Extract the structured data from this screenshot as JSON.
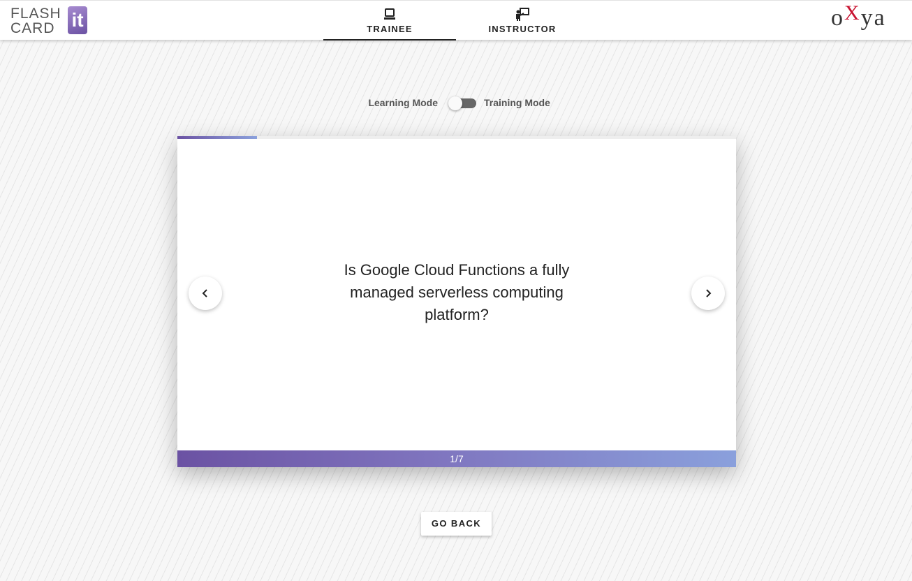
{
  "header": {
    "logo_left": {
      "line1": "FLASH",
      "line2": "CARD",
      "badge": "it"
    },
    "tabs": [
      {
        "label": "TRAINEE",
        "icon": "laptop-icon",
        "active": true
      },
      {
        "label": "INSTRUCTOR",
        "icon": "presenter-icon",
        "active": false
      }
    ],
    "logo_right": {
      "part1": "o",
      "part2": "X",
      "part3": "ya"
    }
  },
  "mode": {
    "left_label": "Learning Mode",
    "right_label": "Training Mode",
    "training_enabled": false
  },
  "card": {
    "question": "Is Google Cloud Functions a fully managed serverless computing platform?",
    "counter": "1/7",
    "progress_fraction": 0.143
  },
  "actions": {
    "go_back": "GO BACK"
  },
  "colors": {
    "accent_start": "#6b52a3",
    "accent_end": "#8aa0dc",
    "logo_right_accent": "#c8102e"
  }
}
